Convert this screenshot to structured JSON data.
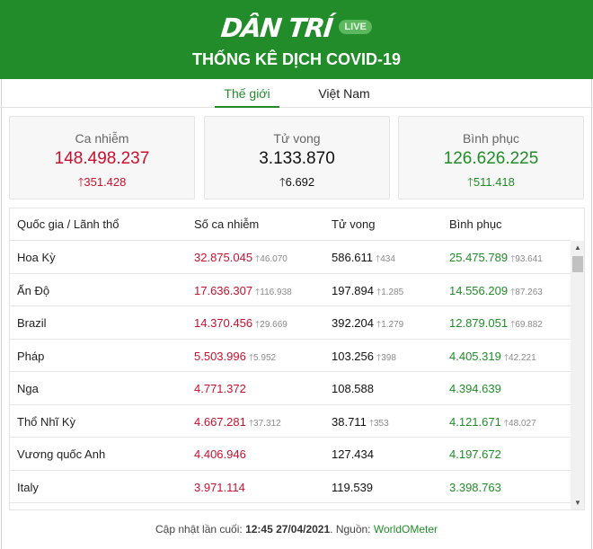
{
  "header": {
    "logo": "DÂN TRÍ",
    "live_badge": "LIVE",
    "title": "THỐNG KÊ DỊCH COVID-19"
  },
  "tabs": [
    {
      "label": "Thế giới",
      "active": true
    },
    {
      "label": "Việt Nam",
      "active": false
    }
  ],
  "summary": {
    "cases": {
      "label": "Ca nhiễm",
      "value": "148.498.237",
      "delta": "351.428"
    },
    "deaths": {
      "label": "Tử vong",
      "value": "3.133.870",
      "delta": "6.692"
    },
    "recovered": {
      "label": "Bình phục",
      "value": "126.626.225",
      "delta": "511.418"
    }
  },
  "table": {
    "headers": [
      "Quốc gia / Lãnh thổ",
      "Số ca nhiễm",
      "Tử vong",
      "Bình phục"
    ],
    "rows": [
      {
        "country": "Hoa Kỳ",
        "cases": "32.875.045",
        "cases_delta": "46.070",
        "deaths": "586.611",
        "deaths_delta": "434",
        "recovered": "25.475.789",
        "recovered_delta": "93.641"
      },
      {
        "country": "Ấn Độ",
        "cases": "17.636.307",
        "cases_delta": "116.938",
        "deaths": "197.894",
        "deaths_delta": "1.285",
        "recovered": "14.556.209",
        "recovered_delta": "87.263"
      },
      {
        "country": "Brazil",
        "cases": "14.370.456",
        "cases_delta": "29.669",
        "deaths": "392.204",
        "deaths_delta": "1.279",
        "recovered": "12.879.051",
        "recovered_delta": "69.882"
      },
      {
        "country": "Pháp",
        "cases": "5.503.996",
        "cases_delta": "5.952",
        "deaths": "103.256",
        "deaths_delta": "398",
        "recovered": "4.405.319",
        "recovered_delta": "42.221"
      },
      {
        "country": "Nga",
        "cases": "4.771.372",
        "cases_delta": "",
        "deaths": "108.588",
        "deaths_delta": "",
        "recovered": "4.394.639",
        "recovered_delta": ""
      },
      {
        "country": "Thổ Nhĩ Kỳ",
        "cases": "4.667.281",
        "cases_delta": "37.312",
        "deaths": "38.711",
        "deaths_delta": "353",
        "recovered": "4.121.671",
        "recovered_delta": "48.027"
      },
      {
        "country": "Vương quốc Anh",
        "cases": "4.406.946",
        "cases_delta": "",
        "deaths": "127.434",
        "deaths_delta": "",
        "recovered": "4.197.672",
        "recovered_delta": ""
      },
      {
        "country": "Italy",
        "cases": "3.971.114",
        "cases_delta": "",
        "deaths": "119.539",
        "deaths_delta": "",
        "recovered": "3.398.763",
        "recovered_delta": ""
      }
    ]
  },
  "footer": {
    "prefix": "Cập nhật lần cuối:",
    "time": "12:45 27/04/2021",
    "source_label": ". Nguồn:",
    "source": "WorldOMeter"
  },
  "colors": {
    "brand_green": "#218c29",
    "cases_red": "#c8102e"
  },
  "icons": {
    "delta": "arrow-up-icon",
    "scroll_up": "scroll-up-arrow-icon",
    "scroll_down": "scroll-down-arrow-icon"
  }
}
